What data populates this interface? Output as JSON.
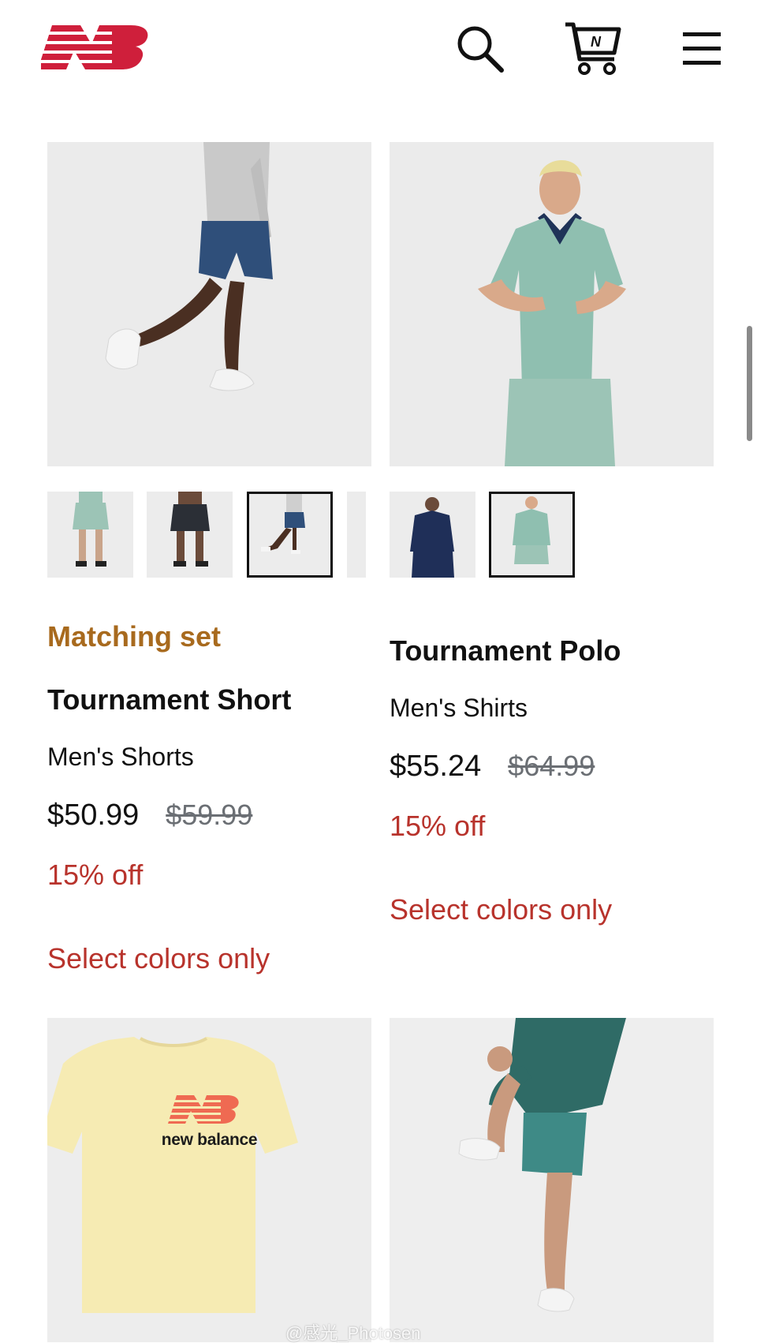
{
  "header": {
    "logo": "new-balance-logo",
    "icons": [
      "search-icon",
      "cart-icon",
      "menu-icon"
    ],
    "cart_icon_letter": "N"
  },
  "colors": {
    "brand_red": "#cf1f3b",
    "badge_orange": "#a86a1e",
    "sale_red": "#b8332c",
    "strike_gray": "#6b6f74"
  },
  "products": [
    {
      "badge": "Matching set",
      "title": "Tournament Short",
      "category": "Men's Shorts",
      "price_now": "$50.99",
      "price_was": "$59.99",
      "discount": "15% off",
      "note": "Select colors only",
      "thumbnails": [
        "sage-shorts",
        "black-shorts",
        "navy-shorts-active",
        "partial"
      ]
    },
    {
      "badge": "",
      "title": "Tournament Polo",
      "category": "Men's Shirts",
      "price_now": "$55.24",
      "price_was": "$64.99",
      "discount": "15% off",
      "note": "Select colors only",
      "thumbnails": [
        "navy-polo",
        "sage-polo-active"
      ]
    }
  ],
  "bottom_products": {
    "tee_print": "new balance"
  },
  "watermark": "@感光_Photosen"
}
